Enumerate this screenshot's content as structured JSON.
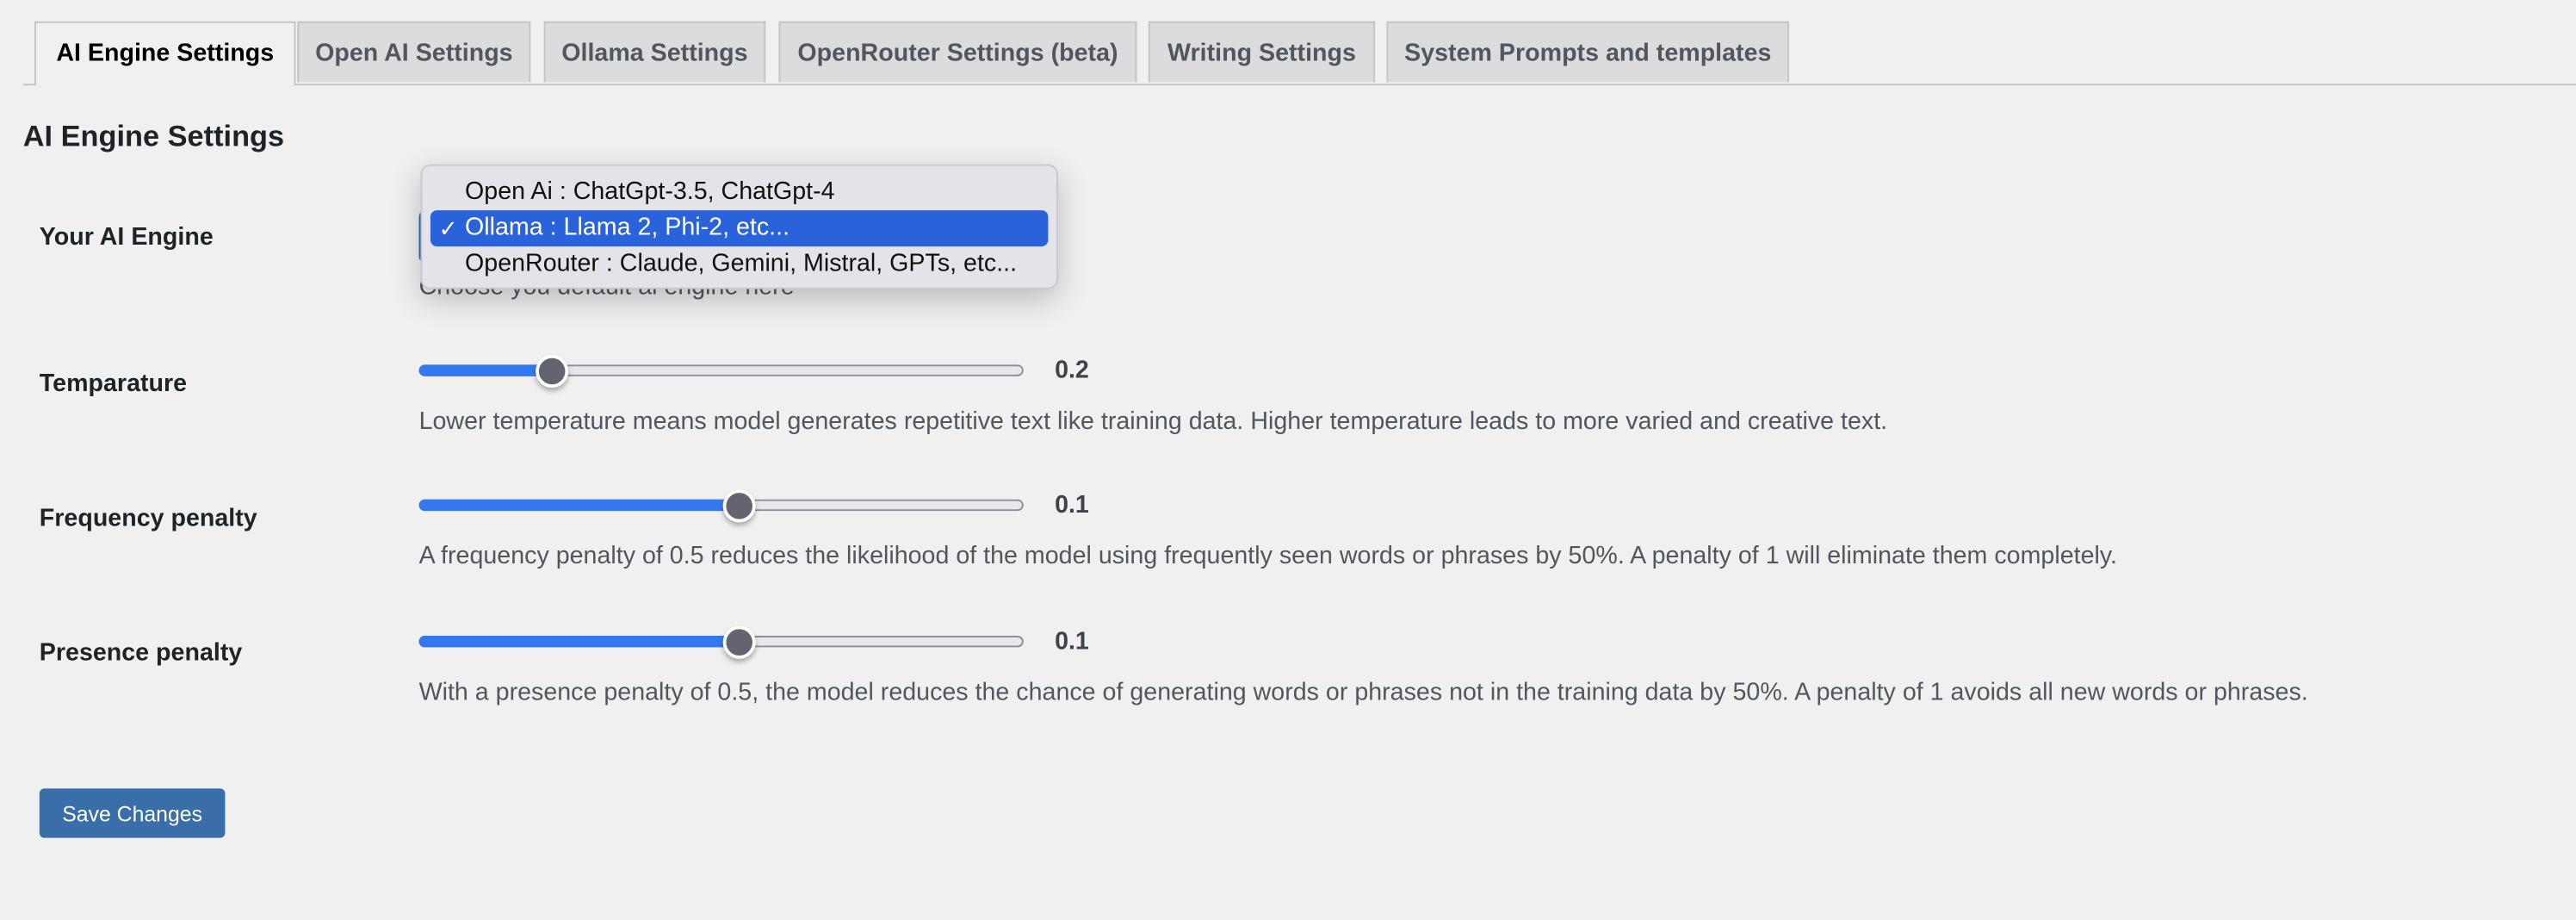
{
  "tabs": [
    {
      "label": "AI Engine Settings",
      "active": true
    },
    {
      "label": "Open AI Settings",
      "active": false
    },
    {
      "label": "Ollama Settings",
      "active": false
    },
    {
      "label": "OpenRouter Settings (beta)",
      "active": false
    },
    {
      "label": "Writing Settings",
      "active": false
    },
    {
      "label": "System Prompts and templates",
      "active": false
    }
  ],
  "page_title": "AI Engine Settings",
  "engine": {
    "label": "Your AI Engine",
    "description": "Choose you default ai engine here",
    "selected": "Ollama : Llama 2, Phi-2, etc...",
    "options": [
      {
        "label": "Open Ai : ChatGpt-3.5, ChatGpt-4",
        "selected": false
      },
      {
        "label": "Ollama : Llama 2, Phi-2, etc...",
        "selected": true
      },
      {
        "label": "OpenRouter : Claude, Gemini, Mistral, GPTs, etc...",
        "selected": false
      }
    ],
    "check_icon": "✓"
  },
  "sliders": [
    {
      "label": "Temparature",
      "value_text": "0.2",
      "fill_fraction": 0.22,
      "description": "Lower temperature means model generates repetitive text like training data. Higher temperature leads to more varied and creative text."
    },
    {
      "label": "Frequency penalty",
      "value_text": "0.1",
      "fill_fraction": 0.53,
      "description": "A frequency penalty of 0.5 reduces the likelihood of the model using frequently seen words or phrases by 50%. A penalty of 1 will eliminate them completely."
    },
    {
      "label": "Presence penalty",
      "value_text": "0.1",
      "fill_fraction": 0.53,
      "description": "With a presence penalty of 0.5, the model reduces the chance of generating words or phrases not in the training data by 50%. A penalty of 1 avoids all new words or phrases."
    }
  ],
  "save_button": "Save Changes",
  "colors": {
    "accent": "#3478f0",
    "selected_option": "#2a62d9",
    "button": "#3a6ea8",
    "background": "#f0f0f1"
  }
}
